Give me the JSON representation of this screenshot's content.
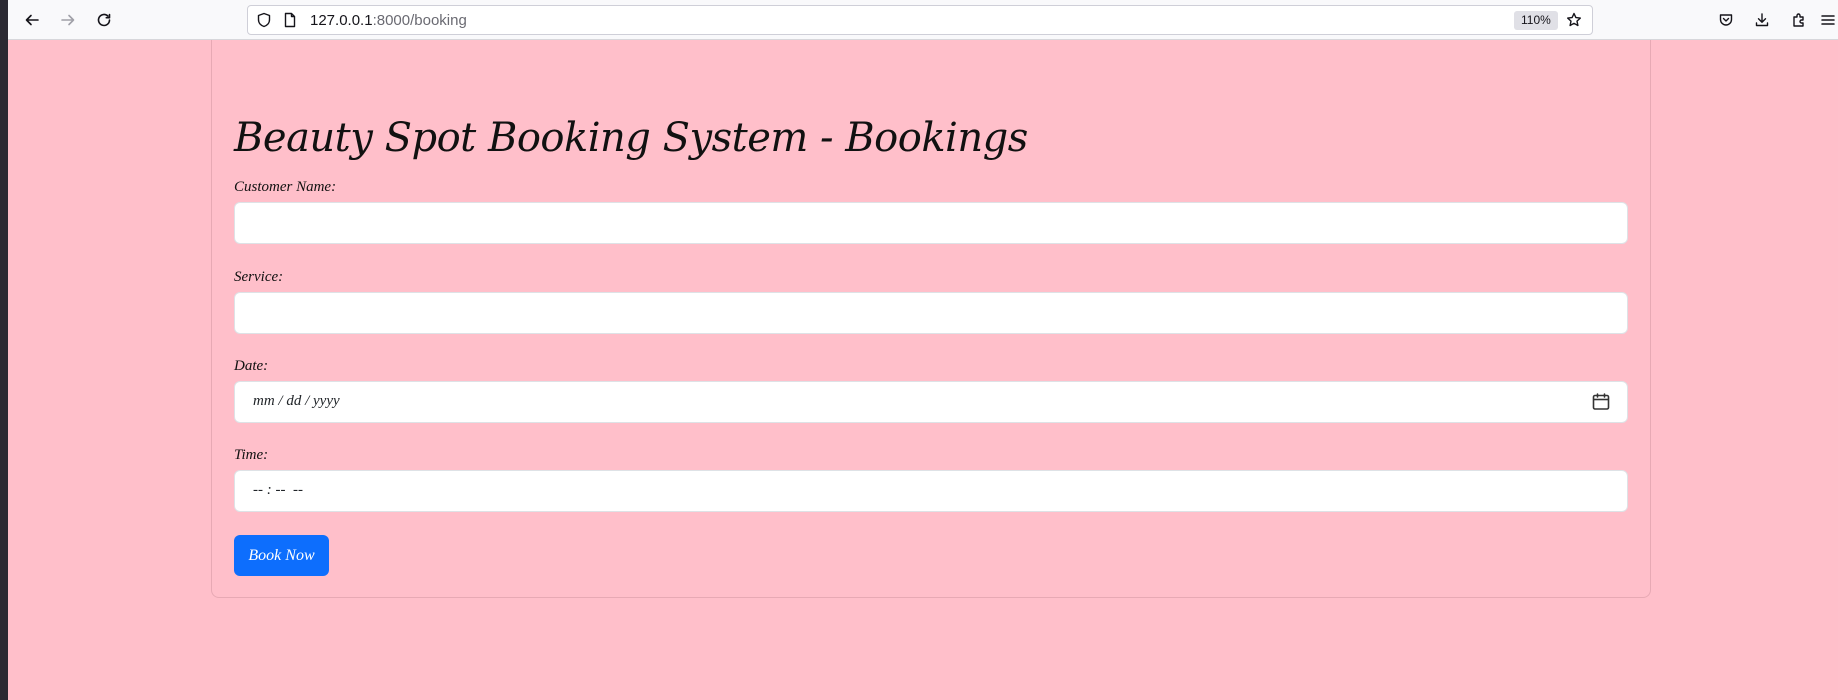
{
  "browser": {
    "url_host": "127.0.0.1",
    "url_path": ":8000/booking",
    "zoom": "110%"
  },
  "page": {
    "title": "Beauty Spot Booking System - Bookings",
    "fields": {
      "customer_name": {
        "label": "Customer Name:",
        "value": ""
      },
      "service": {
        "label": "Service:",
        "value": ""
      },
      "date": {
        "label": "Date:",
        "placeholder": "mm / dd / yyyy"
      },
      "time": {
        "label": "Time:",
        "placeholder": "-- : --  --"
      }
    },
    "submit_label": "Book Now"
  },
  "colors": {
    "page_background": "#ffbfca",
    "button": "#0d6efd"
  },
  "icons": [
    "back-icon",
    "forward-icon",
    "reload-icon",
    "shield-icon",
    "page-icon",
    "star-icon",
    "pocket-icon",
    "download-icon",
    "extensions-icon",
    "menu-icon",
    "calendar-icon"
  ]
}
